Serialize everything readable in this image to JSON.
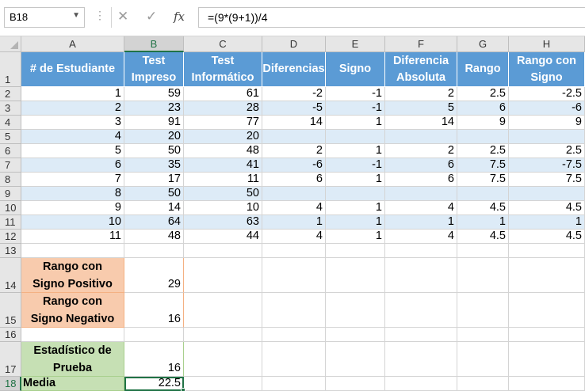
{
  "formula_bar": {
    "name_box": "B18",
    "formula": "=(9*(9+1))/4",
    "cancel_icon": "✕",
    "enter_icon": "✓",
    "fx_label": "fx",
    "dots": "⋮"
  },
  "columns": [
    "A",
    "B",
    "C",
    "D",
    "E",
    "F",
    "G",
    "H"
  ],
  "rows": [
    "1",
    "2",
    "3",
    "4",
    "5",
    "6",
    "7",
    "8",
    "9",
    "10",
    "11",
    "12",
    "13",
    "14",
    "15",
    "16",
    "17",
    "18"
  ],
  "headers": [
    "# de Estudiante",
    "Test Impreso",
    "Test Informático",
    "Diferencias",
    "Signo",
    "Diferencia Absoluta",
    "Rango",
    "Rango con Signo"
  ],
  "table": [
    [
      "1",
      "59",
      "61",
      "-2",
      "-1",
      "2",
      "2.5",
      "-2.5"
    ],
    [
      "2",
      "23",
      "28",
      "-5",
      "-1",
      "5",
      "6",
      "-6"
    ],
    [
      "3",
      "91",
      "77",
      "14",
      "1",
      "14",
      "9",
      "9"
    ],
    [
      "4",
      "20",
      "20",
      "",
      "",
      "",
      "",
      ""
    ],
    [
      "5",
      "50",
      "48",
      "2",
      "1",
      "2",
      "2.5",
      "2.5"
    ],
    [
      "6",
      "35",
      "41",
      "-6",
      "-1",
      "6",
      "7.5",
      "-7.5"
    ],
    [
      "7",
      "17",
      "11",
      "6",
      "1",
      "6",
      "7.5",
      "7.5"
    ],
    [
      "8",
      "50",
      "50",
      "",
      "",
      "",
      "",
      ""
    ],
    [
      "9",
      "14",
      "10",
      "4",
      "1",
      "4",
      "4.5",
      "4.5"
    ],
    [
      "10",
      "64",
      "63",
      "1",
      "1",
      "1",
      "1",
      "1"
    ],
    [
      "11",
      "48",
      "44",
      "4",
      "1",
      "4",
      "4.5",
      "4.5"
    ]
  ],
  "summary": {
    "pos_label": "Rango con Signo Positivo",
    "pos_value": "29",
    "neg_label": "Rango con Signo Negativo",
    "neg_value": "16",
    "stat_label": "Estadístico de Prueba",
    "stat_value": "16",
    "media_label": "Media",
    "media_value": "22.5"
  },
  "colors": {
    "header_blue": "#5b9bd5",
    "band_blue": "#ddebf7",
    "orange": "#f8cbad",
    "green": "#c6e0b4",
    "excel_green": "#217346"
  }
}
